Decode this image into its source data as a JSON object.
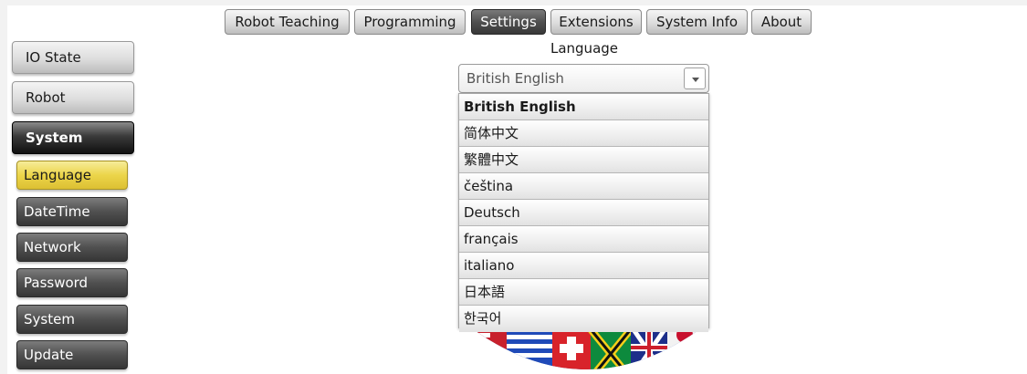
{
  "topnav": {
    "tabs": [
      {
        "label": "Robot Teaching"
      },
      {
        "label": "Programming"
      },
      {
        "label": "Settings"
      },
      {
        "label": "Extensions"
      },
      {
        "label": "System Info"
      },
      {
        "label": "About"
      }
    ],
    "active": "Settings"
  },
  "sidebar": {
    "main": [
      {
        "label": "IO State"
      },
      {
        "label": "Robot"
      },
      {
        "label": "System"
      }
    ],
    "active_main": "System",
    "sub": [
      {
        "label": "Language"
      },
      {
        "label": "DateTime"
      },
      {
        "label": "Network"
      },
      {
        "label": "Password"
      },
      {
        "label": "System"
      },
      {
        "label": "Update"
      }
    ],
    "active_sub": "Language"
  },
  "language": {
    "title": "Language",
    "selected": "British English",
    "options": [
      "British English",
      "简体中文",
      "繁體中文",
      "čeština",
      "Deutsch",
      "français",
      "italiano",
      "日本語",
      "한국어"
    ]
  },
  "colors": {
    "active_sub": "#ecd54a",
    "active_tab": "#505050"
  },
  "icons": {
    "dropdown_arrow": "chevron-down-icon",
    "flags_image": "flags-globe-icon"
  }
}
